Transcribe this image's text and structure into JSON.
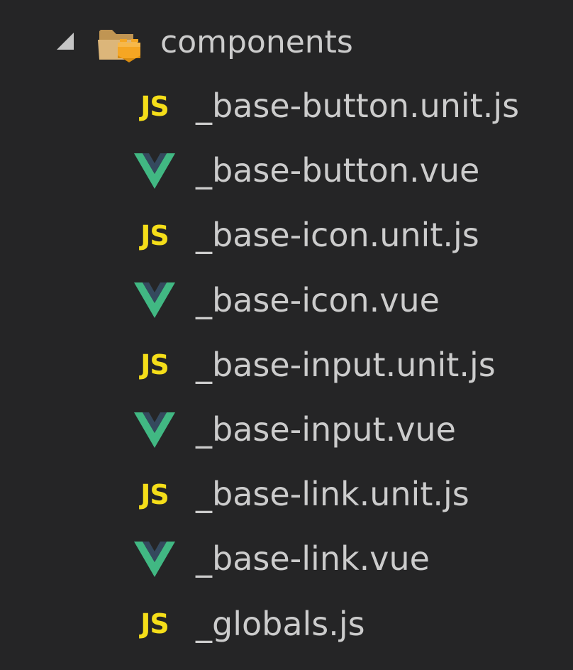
{
  "folder": {
    "name": "components",
    "icon": "folder-open-lego-icon",
    "expanded": true
  },
  "files": [
    {
      "name": "_base-button.unit.js",
      "type": "js",
      "icon": "js-icon",
      "icon_label": "JS"
    },
    {
      "name": "_base-button.vue",
      "type": "vue",
      "icon": "vue-icon"
    },
    {
      "name": "_base-icon.unit.js",
      "type": "js",
      "icon": "js-icon",
      "icon_label": "JS"
    },
    {
      "name": "_base-icon.vue",
      "type": "vue",
      "icon": "vue-icon"
    },
    {
      "name": "_base-input.unit.js",
      "type": "js",
      "icon": "js-icon",
      "icon_label": "JS"
    },
    {
      "name": "_base-input.vue",
      "type": "vue",
      "icon": "vue-icon"
    },
    {
      "name": "_base-link.unit.js",
      "type": "js",
      "icon": "js-icon",
      "icon_label": "JS"
    },
    {
      "name": "_base-link.vue",
      "type": "vue",
      "icon": "vue-icon"
    },
    {
      "name": "_globals.js",
      "type": "js",
      "icon": "js-icon",
      "icon_label": "JS"
    }
  ],
  "colors": {
    "background": "#252526",
    "text": "#cccccc",
    "js_icon": "#f5de19",
    "vue_green": "#41b883",
    "vue_dark": "#34495e",
    "folder": "#dcb67a",
    "lego": "#f5a623"
  }
}
